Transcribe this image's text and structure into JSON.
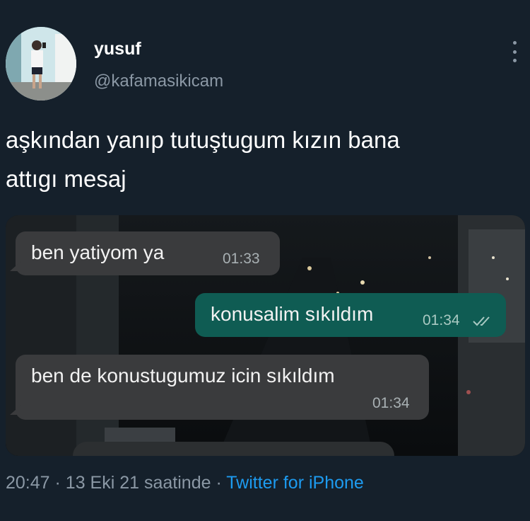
{
  "author": {
    "display_name": "yusuf",
    "handle": "@kafamasikicam"
  },
  "tweet": {
    "line1": "aşkından yanıp tutuştugum kızın bana",
    "line2": "attıgı mesaj"
  },
  "chat": {
    "messages": [
      {
        "text": "ben yatiyom ya",
        "time": "01:33",
        "direction": "incoming"
      },
      {
        "text": "konusalim sıkıldım",
        "time": "01:34",
        "direction": "outgoing"
      },
      {
        "text": "ben de konustugumuz icin sıkıldım",
        "time": "01:34",
        "direction": "incoming"
      }
    ]
  },
  "footer": {
    "time": "20:47",
    "separator": "·",
    "date": "13 Eki 21 saatinde",
    "source": "Twitter for iPhone"
  },
  "icons": {
    "more": "more-vertical-icon",
    "read_receipt": "double-check-icon"
  },
  "colors": {
    "background": "#15202b",
    "secondary_text": "#8b98a5",
    "link": "#1d9bf0",
    "outgoing_bubble": "#0f5c53",
    "incoming_bubble": "#3a3b3d"
  }
}
